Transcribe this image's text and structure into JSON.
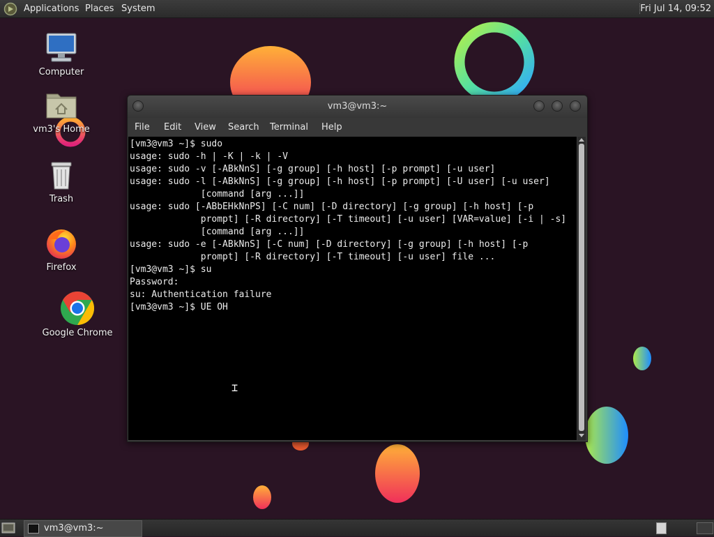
{
  "top_panel": {
    "menus": {
      "applications": "Applications",
      "places": "Places",
      "system": "System"
    },
    "clock": "Fri Jul 14, 09:52"
  },
  "desktop": {
    "icons": {
      "computer": "Computer",
      "home": "vm3's Home",
      "trash": "Trash",
      "firefox": "Firefox",
      "chrome": "Google Chrome"
    }
  },
  "terminal": {
    "title": "vm3@vm3:~",
    "menu": {
      "file": "File",
      "edit": "Edit",
      "view": "View",
      "search": "Search",
      "terminal": "Terminal",
      "help": "Help"
    },
    "lines": [
      "[vm3@vm3 ~]$ sudo",
      "usage: sudo -h | -K | -k | -V",
      "usage: sudo -v [-ABkNnS] [-g group] [-h host] [-p prompt] [-u user]",
      "usage: sudo -l [-ABkNnS] [-g group] [-h host] [-p prompt] [-U user] [-u user]",
      "             [command [arg ...]]",
      "usage: sudo [-ABbEHkNnPS] [-C num] [-D directory] [-g group] [-h host] [-p",
      "             prompt] [-R directory] [-T timeout] [-u user] [VAR=value] [-i | -s]",
      "             [command [arg ...]]",
      "usage: sudo -e [-ABkNnS] [-C num] [-D directory] [-g group] [-h host] [-p",
      "             prompt] [-R directory] [-T timeout] [-u user] file ...",
      "[vm3@vm3 ~]$ su",
      "Password:",
      "su: Authentication failure",
      "[vm3@vm3 ~]$ UE OH"
    ]
  },
  "taskbar": {
    "task_label": "vm3@vm3:~"
  },
  "colors": {
    "desktop_bg": "#2a1424",
    "terminal_bg": "#000000",
    "panel_bg": "#2f2f2f"
  }
}
